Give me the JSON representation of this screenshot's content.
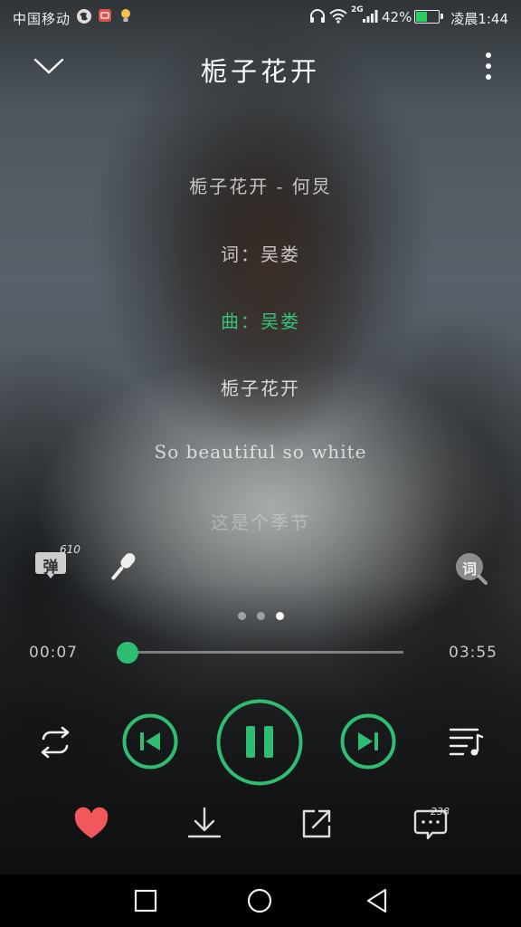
{
  "status_bar": {
    "carrier": "中国移动",
    "network": "2G",
    "battery": "42%",
    "time": "凌晨1:44"
  },
  "header": {
    "title": "栀子花开"
  },
  "lyrics": [
    "栀子花开 - 何炅",
    "词：吴娄",
    "曲：吴娄",
    "栀子花开",
    "So beautiful so white",
    "这是个季节"
  ],
  "danmu": {
    "label": "弹",
    "count": "610"
  },
  "lyric_button": {
    "label": "词"
  },
  "pager": {
    "pages": 3,
    "active": 2
  },
  "progress": {
    "current": "00:07",
    "total": "03:55",
    "fraction": 0.03
  },
  "comments": {
    "count": "238"
  },
  "colors": {
    "accent": "#2ebd73",
    "like": "#f0585d"
  },
  "icons": {
    "header": [
      "chevron-down-icon",
      "more-vert-icon"
    ],
    "controls": [
      "repeat-icon",
      "previous-icon",
      "pause-icon",
      "next-icon",
      "playlist-icon"
    ],
    "actions": [
      "heart-icon",
      "download-icon",
      "share-icon",
      "comment-icon"
    ],
    "nav": [
      "recent-apps-icon",
      "home-icon",
      "back-icon"
    ]
  }
}
